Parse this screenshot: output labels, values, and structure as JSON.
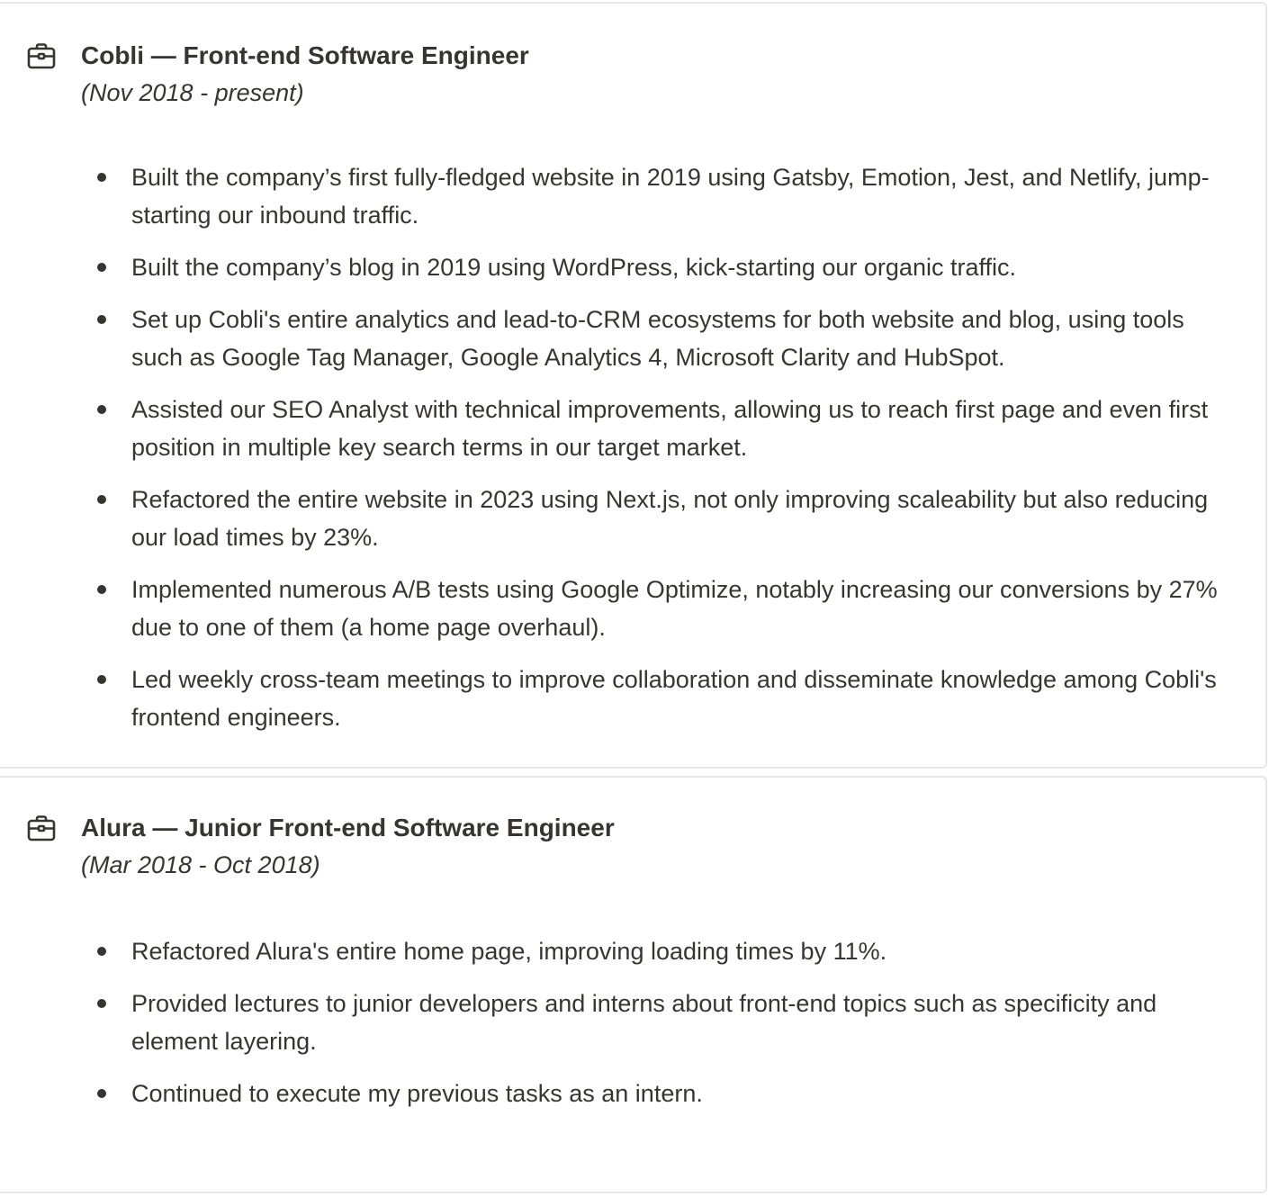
{
  "jobs": [
    {
      "icon": "briefcase-icon",
      "title": "Cobli — Front-end Software Engineer",
      "period": "(Nov 2018 - present)",
      "bullets": [
        "Built the company’s first fully-fledged website in 2019 using Gatsby, Emotion, Jest, and Netlify, jump-starting our inbound traffic.",
        "Built the company’s blog in 2019 using WordPress, kick-starting our organic traffic.",
        "Set up Cobli's entire analytics and lead-to-CRM ecosystems for both website and blog, using tools such as Google Tag Manager, Google Analytics 4, Microsoft Clarity and HubSpot.",
        "Assisted our SEO Analyst with technical improvements, allowing us to reach first page and even first position in multiple key search terms in our target market.",
        "Refactored the entire website in 2023 using Next.js, not only improving scaleability but also reducing our load times by 23%.",
        "Implemented numerous A/B tests using Google Optimize, notably increasing our conversions by 27% due to one of them (a home page overhaul).",
        "Led weekly cross-team meetings to improve collaboration and disseminate knowledge among Cobli's frontend engineers."
      ]
    },
    {
      "icon": "briefcase-icon",
      "title": "Alura — Junior Front-end Software Engineer",
      "period": "(Mar 2018 - Oct 2018)",
      "bullets": [
        "Refactored Alura's entire home page, improving loading times by 11%.",
        "Provided lectures to junior developers and interns about front-end topics such as specificity and element layering.",
        "Continued to execute my previous tasks as an intern."
      ]
    }
  ]
}
